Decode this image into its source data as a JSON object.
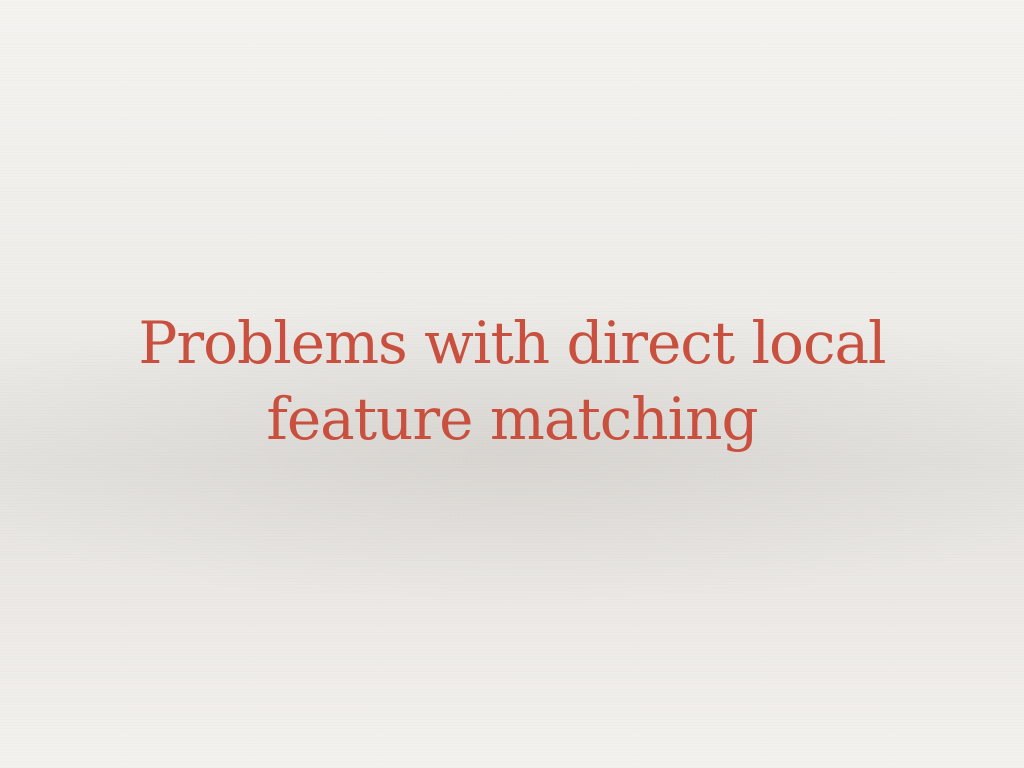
{
  "slide": {
    "title": "Problems with direct local feature matching"
  },
  "colors": {
    "title": "#c9503e",
    "background": "#efedea"
  }
}
